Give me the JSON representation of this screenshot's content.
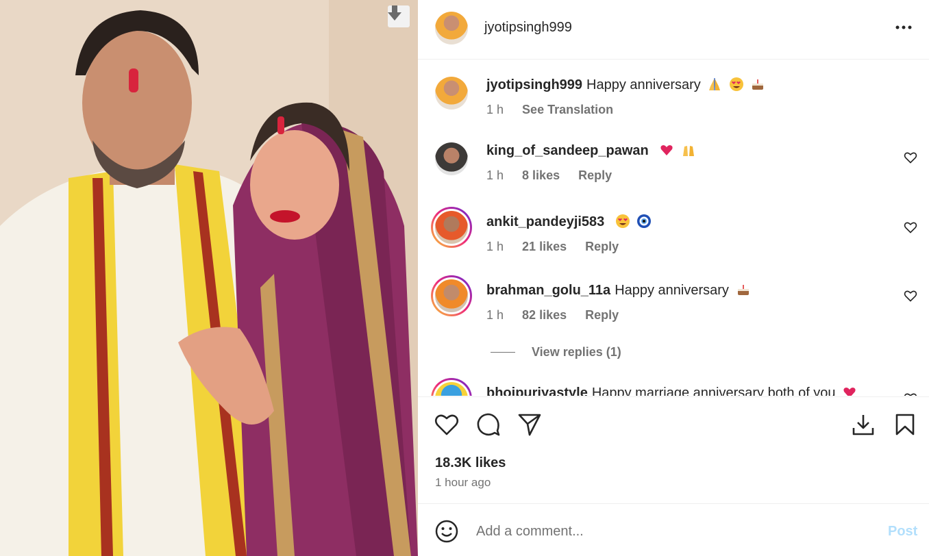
{
  "post": {
    "author": "jyotipsingh999",
    "more_icon": "more-options-icon"
  },
  "caption": {
    "username": "jyotipsingh999",
    "text": "Happy anniversary",
    "time": "1 h",
    "see_translation": "See Translation"
  },
  "comments": [
    {
      "username": "king_of_sandeep_pawan",
      "text": "",
      "time": "1 h",
      "likes": "8 likes",
      "reply": "Reply"
    },
    {
      "username": "ankit_pandeyji583",
      "text": "",
      "time": "1 h",
      "likes": "21 likes",
      "reply": "Reply"
    },
    {
      "username": "brahman_golu_11a",
      "text": "Happy anniversary",
      "time": "1 h",
      "likes": "82 likes",
      "reply": "Reply"
    },
    {
      "username": "bhojpuriyastyle",
      "text": "Happy marriage anniversary both of you"
    }
  ],
  "view_replies": "View replies (1)",
  "stats": {
    "likes": "18.3K likes",
    "time_ago": "1 hour ago"
  },
  "composer": {
    "placeholder": "Add a comment...",
    "post_label": "Post"
  },
  "colors": {
    "post_disabled": "#b2dffc",
    "secondary_text": "#737373",
    "heart_red": "#e0245e"
  }
}
